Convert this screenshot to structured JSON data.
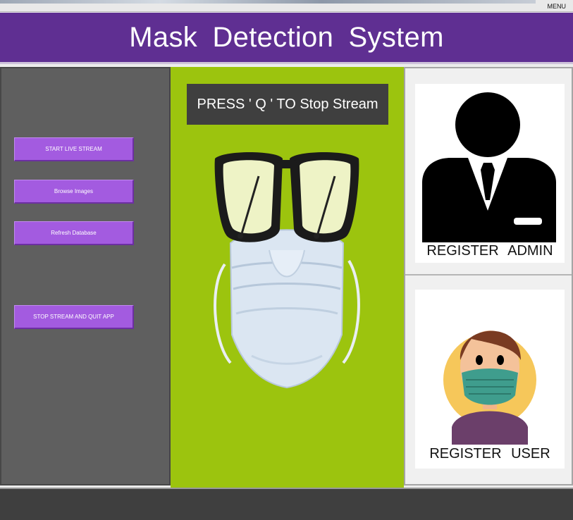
{
  "menu": {
    "label": "MENU"
  },
  "header": {
    "title": "Mask Detection System"
  },
  "left_panel": {
    "buttons": {
      "start": "START LIVE STREAM",
      "browse": "Browse Images",
      "refresh": "Refresh Database",
      "stop": "STOP STREAM AND QUIT APP"
    }
  },
  "center_panel": {
    "press_label": "PRESS ' Q ' TO Stop Stream",
    "image": "mask-with-glasses"
  },
  "right_panel": {
    "admin_label": "REGISTER  ADMIN",
    "user_label": "REGISTER  USER",
    "admin_icon": "admin-silhouette-icon",
    "user_icon": "masked-user-avatar"
  },
  "colors": {
    "title_bar": "#5f2f92",
    "button": "#a35be0",
    "center_bg": "#9cc40e",
    "left_bg": "#5f5f5f",
    "bottom_bar": "#3f3f3f"
  }
}
